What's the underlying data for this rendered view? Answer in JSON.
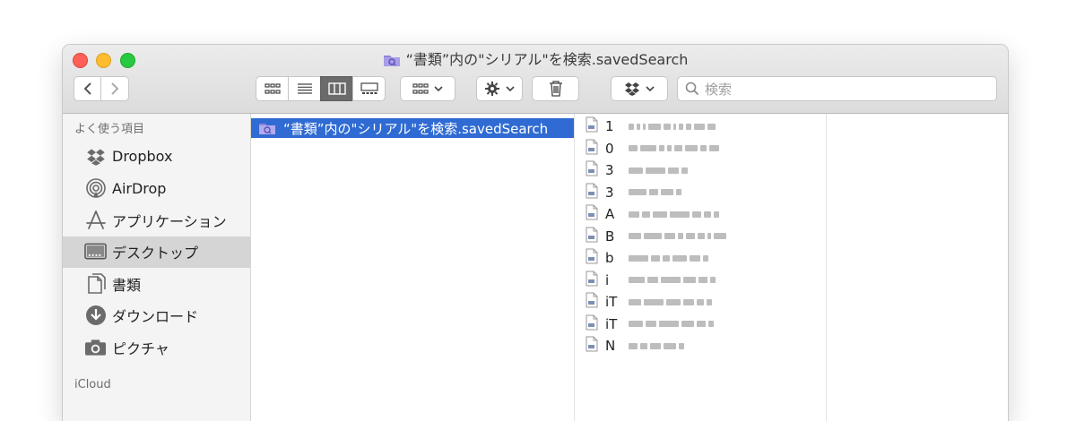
{
  "window": {
    "title": "“書類”内の\"シリアル\"を検索.savedSearch"
  },
  "toolbar": {
    "back_icon": "chevron-left-icon",
    "forward_icon": "chevron-right-icon",
    "view_modes": [
      "icon-view-icon",
      "list-view-icon",
      "column-view-icon",
      "gallery-view-icon"
    ],
    "active_view": "column-view-icon",
    "search_placeholder": "検索"
  },
  "sidebar": {
    "favorites_label": "よく使う項目",
    "items": [
      {
        "label": "Dropbox",
        "icon": "dropbox-icon"
      },
      {
        "label": "AirDrop",
        "icon": "airdrop-icon"
      },
      {
        "label": "アプリケーション",
        "icon": "applications-icon"
      },
      {
        "label": "デスクトップ",
        "icon": "desktop-icon",
        "selected": true
      },
      {
        "label": "書類",
        "icon": "documents-icon"
      },
      {
        "label": "ダウンロード",
        "icon": "downloads-icon"
      },
      {
        "label": "ピクチャ",
        "icon": "pictures-icon"
      }
    ],
    "icloud_label": "iCloud"
  },
  "column1": {
    "selected_item": "“書類”内の\"シリアル\"を検索.savedSearch"
  },
  "column2": {
    "files": [
      {
        "prefix": "1"
      },
      {
        "prefix": "0"
      },
      {
        "prefix": "3"
      },
      {
        "prefix": "3"
      },
      {
        "prefix": "A"
      },
      {
        "prefix": "B"
      },
      {
        "prefix": "b"
      },
      {
        "prefix": "i"
      },
      {
        "prefix": "iT"
      },
      {
        "prefix": "iT"
      },
      {
        "prefix": "N"
      }
    ]
  },
  "colors": {
    "selection": "#2f6bd3",
    "sidebar_bg": "#f4f4f4",
    "toolbar_bg": "#dcdcdc"
  }
}
